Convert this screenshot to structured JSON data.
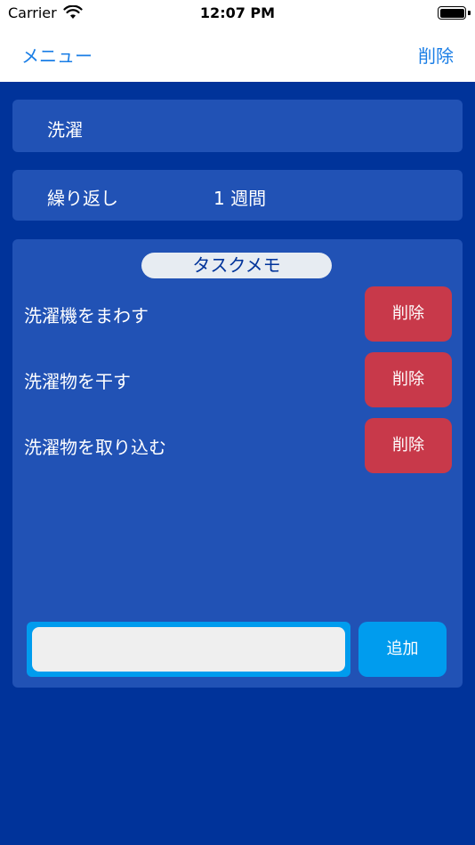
{
  "status_bar": {
    "carrier": "Carrier",
    "time": "12:07 PM",
    "wifi_icon": "wifi-icon",
    "battery_icon": "battery-icon"
  },
  "nav": {
    "left_label": "メニュー",
    "right_label": "削除"
  },
  "task": {
    "title": "洗濯",
    "repeat_label": "繰り返し",
    "repeat_value": "1 週間"
  },
  "memo": {
    "header": "タスクメモ",
    "items": [
      {
        "text": "洗濯機をまわす",
        "delete_label": "削除"
      },
      {
        "text": "洗濯物を干す",
        "delete_label": "削除"
      },
      {
        "text": "洗濯物を取り込む",
        "delete_label": "削除"
      }
    ],
    "input_value": "",
    "input_placeholder": "",
    "add_label": "追加"
  },
  "colors": {
    "background": "#00339a",
    "card": "#2152b5",
    "delete": "#c8394a",
    "accent": "#009cee",
    "link": "#1a7ee6"
  }
}
